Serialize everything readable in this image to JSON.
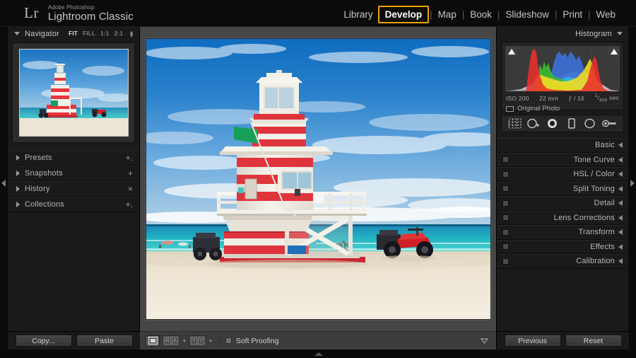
{
  "app": {
    "logo_mark": "Lr",
    "brand_superline": "Adobe Photoshop",
    "brand_name": "Lightroom Classic"
  },
  "modules": {
    "items": [
      {
        "label": "Library",
        "active": false
      },
      {
        "label": "Develop",
        "active": true
      },
      {
        "label": "Map",
        "active": false
      },
      {
        "label": "Book",
        "active": false
      },
      {
        "label": "Slideshow",
        "active": false
      },
      {
        "label": "Print",
        "active": false
      },
      {
        "label": "Web",
        "active": false
      }
    ],
    "separator": "|",
    "active_highlight_color": "#f0a207"
  },
  "left_panel": {
    "navigator": {
      "title": "Navigator",
      "zoom_options": [
        {
          "label": "FIT",
          "selected": true
        },
        {
          "label": "FILL",
          "selected": false
        },
        {
          "label": "1:1",
          "selected": false
        },
        {
          "label": "2:1",
          "selected": false
        }
      ],
      "stepper_icon": "up-down-stepper-icon"
    },
    "sections": [
      {
        "label": "Presets",
        "action": "+.",
        "action_icon": "add-preset-icon"
      },
      {
        "label": "Snapshots",
        "action": "+",
        "action_icon": "add-snapshot-icon"
      },
      {
        "label": "History",
        "action": "×",
        "action_icon": "clear-history-icon"
      },
      {
        "label": "Collections",
        "action": "+.",
        "action_icon": "add-collection-icon"
      }
    ],
    "buttons": [
      {
        "label": "Copy..."
      },
      {
        "label": "Paste"
      }
    ]
  },
  "right_panel": {
    "histogram": {
      "title": "Histogram",
      "collapse_icon": "chevron-down-icon",
      "shadow_clipping_icon": "shadow-clipping-triangle",
      "highlight_clipping_icon": "highlight-clipping-triangle",
      "exif": {
        "iso": "ISO 200",
        "focal_length": "22 mm",
        "aperture": "ƒ / 16",
        "shutter_numerator": "1",
        "shutter_denominator": "400",
        "shutter_unit": "sec"
      },
      "original_photo_label": "Original Photo"
    },
    "tools": [
      {
        "name": "crop-overlay-tool",
        "selected": false
      },
      {
        "name": "spot-removal-tool",
        "selected": false
      },
      {
        "name": "red-eye-correction-tool",
        "selected": true
      },
      {
        "name": "graduated-filter-tool",
        "selected": false
      },
      {
        "name": "radial-filter-tool",
        "selected": false
      },
      {
        "name": "adjustment-brush-tool",
        "selected": false
      }
    ],
    "sections": [
      {
        "label": "Basic",
        "has_switch": false
      },
      {
        "label": "Tone Curve",
        "has_switch": true
      },
      {
        "label": "HSL / Color",
        "has_switch": true
      },
      {
        "label": "Split Toning",
        "has_switch": true
      },
      {
        "label": "Detail",
        "has_switch": true
      },
      {
        "label": "Lens Corrections",
        "has_switch": true
      },
      {
        "label": "Transform",
        "has_switch": true
      },
      {
        "label": "Effects",
        "has_switch": true
      },
      {
        "label": "Calibration",
        "has_switch": true
      }
    ],
    "buttons": [
      {
        "label": "Previous"
      },
      {
        "label": "Reset"
      }
    ]
  },
  "toolbar": {
    "view_loupe_icon": "loupe-view-icon",
    "compare_label_left": "R",
    "compare_label_right": "A",
    "compare_icon": "reference-compare-icon",
    "beforeafter_label_left": "Y",
    "beforeafter_label_right": "Y",
    "beforeafter_icon": "before-after-view-icon",
    "soft_proofing_label": "Soft Proofing",
    "soft_proofing_checked": true,
    "chevron_icon": "chevron-down-icon"
  },
  "edges": {
    "left_arrow_icon": "collapse-left-panel-icon",
    "right_arrow_icon": "collapse-right-panel-icon",
    "bottom_arrow_icon": "show-filmstrip-icon"
  },
  "photo": {
    "alt_name": "miami-beach-lifeguard-tower",
    "sky_top": "#1874c4",
    "sky_bottom": "#8ec3e8",
    "ocean_color": "#2fc0c4",
    "sand_color": "#e9e0cf",
    "tower_red": "#e0343c",
    "tower_white": "#f4f1ea",
    "atv_red": "#cf2026"
  }
}
